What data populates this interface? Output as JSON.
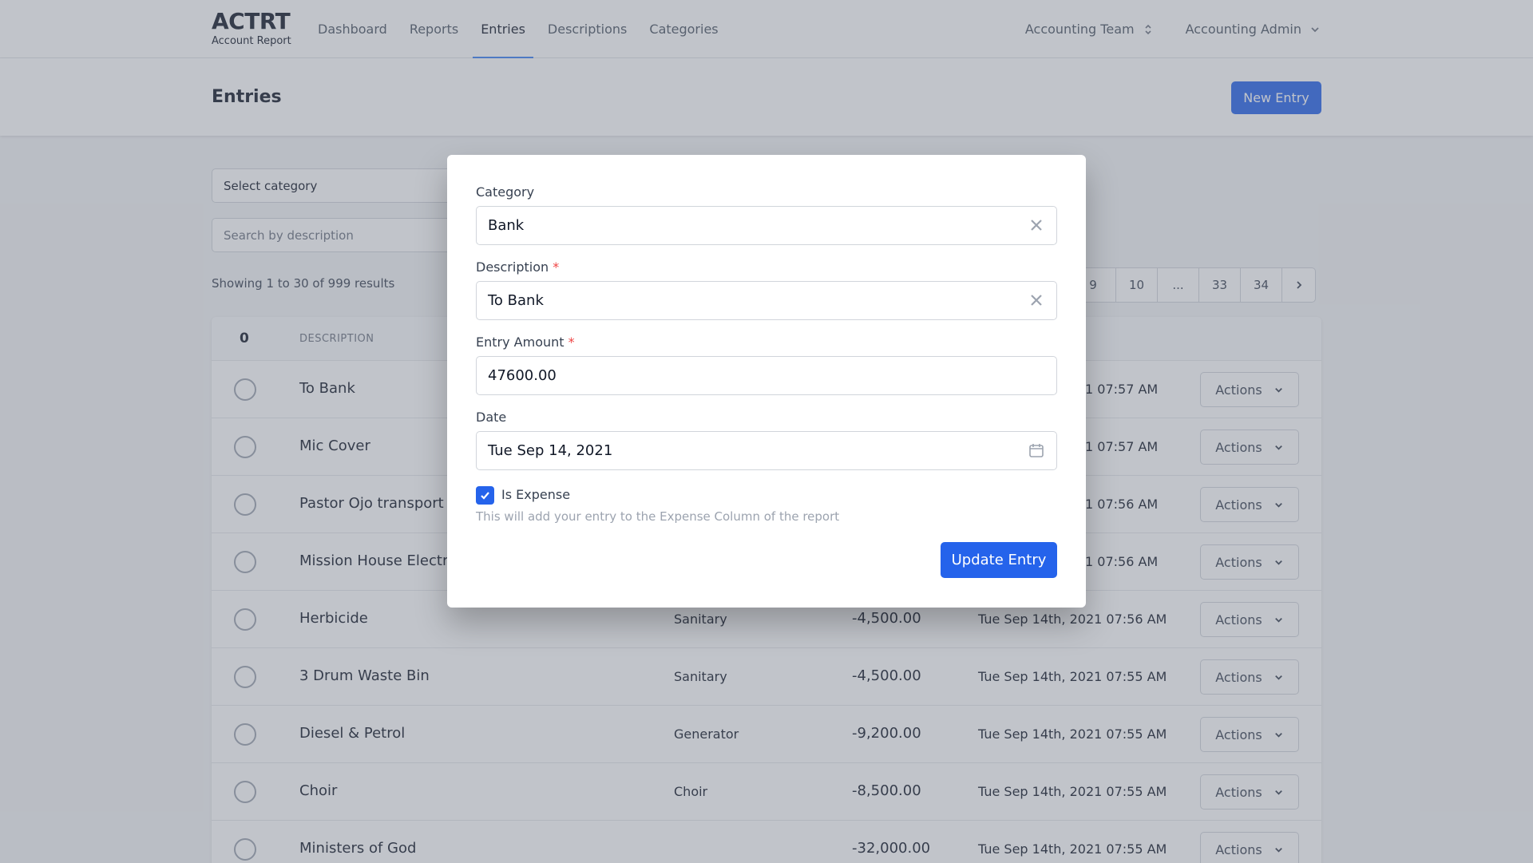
{
  "brand": {
    "title": "ACTRT",
    "subtitle": "Account Report"
  },
  "nav": {
    "links": [
      "Dashboard",
      "Reports",
      "Entries",
      "Descriptions",
      "Categories"
    ],
    "active": "Entries",
    "team": "Accounting Team",
    "user": "Accounting Admin"
  },
  "header": {
    "title": "Entries",
    "new_entry": "New Entry"
  },
  "filters": {
    "category": "Select category",
    "search_placeholder": "Search by description"
  },
  "results": "Showing 1 to 30 of 999 results",
  "pagination": [
    "9",
    "10",
    "...",
    "33",
    "34"
  ],
  "table": {
    "selected_count": "0",
    "col_description": "DESCRIPTION",
    "rows": [
      {
        "description": "To Bank",
        "category": "",
        "amount": "",
        "date": "1 07:57 AM"
      },
      {
        "description": "Mic Cover",
        "category": "",
        "amount": "",
        "date": "1 07:57 AM"
      },
      {
        "description": "Pastor Ojo transport fa",
        "category": "",
        "amount": "",
        "date": "1 07:56 AM"
      },
      {
        "description": "Mission House Electric",
        "category": "",
        "amount": "",
        "date": "1 07:56 AM"
      },
      {
        "description": "Herbicide",
        "category": "Sanitary",
        "amount": "-4,500.00",
        "date": "Tue Sep 14th, 2021 07:56 AM"
      },
      {
        "description": "3 Drum Waste Bin",
        "category": "Sanitary",
        "amount": "-4,500.00",
        "date": "Tue Sep 14th, 2021 07:55 AM"
      },
      {
        "description": "Diesel & Petrol",
        "category": "Generator",
        "amount": "-9,200.00",
        "date": "Tue Sep 14th, 2021 07:55 AM"
      },
      {
        "description": "Choir",
        "category": "Choir",
        "amount": "-8,500.00",
        "date": "Tue Sep 14th, 2021 07:55 AM"
      },
      {
        "description": "Ministers of God",
        "category": "",
        "amount": "-32,000.00",
        "date": "Tue Sep 14th, 2021 07:55 AM"
      }
    ],
    "actions_label": "Actions"
  },
  "modal": {
    "category_label": "Category",
    "category_value": "Bank",
    "description_label": "Description",
    "description_value": "To Bank",
    "amount_label": "Entry Amount",
    "amount_value": "47600.00",
    "date_label": "Date",
    "date_value": "Tue Sep 14, 2021",
    "required_mark": "*",
    "is_expense_label": "Is Expense",
    "is_expense_checked": true,
    "help_text": "This will add your entry to the Expense Column of the report",
    "submit": "Update Entry"
  },
  "colors": {
    "primary": "#2563eb",
    "required": "#ef4444",
    "overlay": "rgba(107,114,128,0.42)"
  }
}
